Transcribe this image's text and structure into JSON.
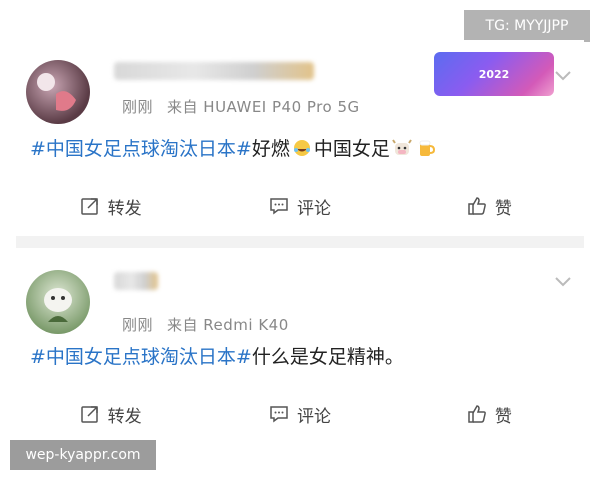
{
  "watermarks": {
    "top_right": "TG: MYYJJPP",
    "bottom_left": "wep-kyappr.com"
  },
  "posts": [
    {
      "time": "刚刚",
      "source": "来自 HUAWEI P40 Pro 5G",
      "badge": "2022",
      "hashtag": "#中国女足点球淘汰日本#",
      "text_a": "好燃",
      "text_b": "中国女足",
      "actions": {
        "repost": "转发",
        "comment": "评论",
        "like": "赞"
      }
    },
    {
      "time": "刚刚",
      "source": "来自 Redmi K40",
      "hashtag": "#中国女足点球淘汰日本#",
      "text_a": "什么是女足精神。",
      "actions": {
        "repost": "转发",
        "comment": "评论",
        "like": "赞"
      }
    }
  ],
  "colors": {
    "hashtag": "#2a74c7",
    "meta": "#888888",
    "divider": "#f2f2f2"
  }
}
